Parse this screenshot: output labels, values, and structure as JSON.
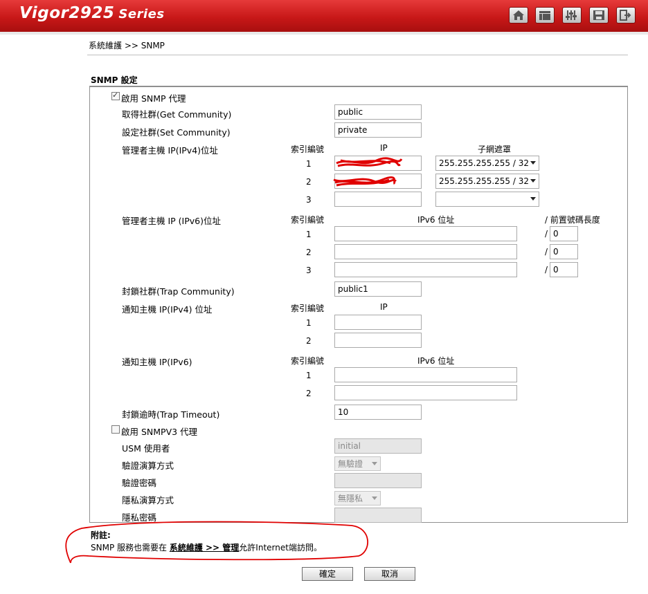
{
  "header": {
    "logo_main": "Vigor2925",
    "logo_series": "Series",
    "icons": [
      "home-icon",
      "quick-start-icon",
      "settings-icon",
      "save-icon",
      "logout-icon"
    ]
  },
  "breadcrumb": "系統維護 >> SNMP",
  "section_title": "SNMP 設定",
  "snmp": {
    "enable_agent_label": "啟用 SNMP 代理",
    "enable_agent_checked": true,
    "get_community_label": "取得社群(Get Community)",
    "get_community_value": "public",
    "set_community_label": "設定社群(Set Community)",
    "set_community_value": "private",
    "manager_ipv4": {
      "label": "管理者主機 IP(IPv4)位址",
      "col_index": "索引編號",
      "col_ip": "IP",
      "col_mask": "子網遮罩",
      "rows": [
        {
          "index": "1",
          "ip": "",
          "mask": "255.255.255.255 / 32"
        },
        {
          "index": "2",
          "ip": "",
          "mask": "255.255.255.255 / 32"
        },
        {
          "index": "3",
          "ip": "",
          "mask": ""
        }
      ]
    },
    "manager_ipv6": {
      "label": "管理者主機 IP (IPv6)位址",
      "col_index": "索引編號",
      "col_ip": "IPv6 位址",
      "col_prefix": "/ 前置號碼長度",
      "rows": [
        {
          "index": "1",
          "ip": "",
          "slash": "/",
          "prefix": "0"
        },
        {
          "index": "2",
          "ip": "",
          "slash": "/",
          "prefix": "0"
        },
        {
          "index": "3",
          "ip": "",
          "slash": "/",
          "prefix": "0"
        }
      ]
    },
    "trap_community_label": "封鎖社群(Trap Community)",
    "trap_community_value": "public1",
    "notify_ipv4": {
      "label": "通知主機 IP(IPv4) 位址",
      "col_index": "索引編號",
      "col_ip": "IP",
      "rows": [
        {
          "index": "1",
          "ip": ""
        },
        {
          "index": "2",
          "ip": ""
        }
      ]
    },
    "notify_ipv6": {
      "label": "通知主機 IP(IPv6)",
      "col_index": "索引編號",
      "col_ip": "IPv6 位址",
      "rows": [
        {
          "index": "1",
          "ip": ""
        },
        {
          "index": "2",
          "ip": ""
        }
      ]
    },
    "trap_timeout_label": "封鎖逾時(Trap Timeout)",
    "trap_timeout_value": "10",
    "v3": {
      "enable_label": "啟用 SNMPV3 代理",
      "enable_checked": false,
      "usm_user_label": "USM 使用者",
      "usm_user_value": "initial",
      "auth_algo_label": "驗證演算方式",
      "auth_algo_value": "無驗證",
      "auth_password_label": "驗證密碼",
      "privacy_algo_label": "隱私演算方式",
      "privacy_algo_value": "無隱私",
      "privacy_password_label": "隱私密碼"
    }
  },
  "note": {
    "title": "附註:",
    "text_before": "SNMP 服務也需要在 ",
    "link": "系統維護 >> 管理",
    "text_after": "允許Internet端訪問。"
  },
  "buttons": {
    "ok": "確定",
    "cancel": "取消"
  },
  "colors": {
    "header_red": "#c81818",
    "annotation_red": "#e00000"
  }
}
